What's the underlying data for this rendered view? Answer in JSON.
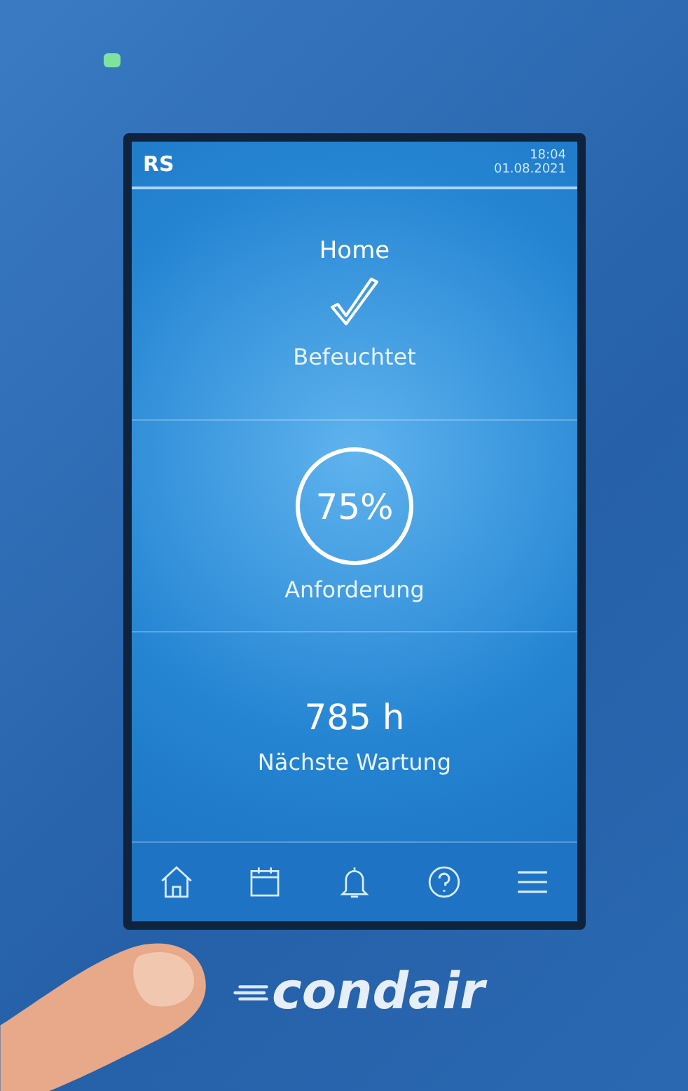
{
  "header": {
    "title": "RS",
    "time": "18:04",
    "date": "01.08.2021"
  },
  "screen_title": "Home",
  "status": {
    "label": "Befeuchtet"
  },
  "demand": {
    "value": "75%",
    "label": "Anforderung"
  },
  "maintenance": {
    "value": "785 h",
    "label": "Nächste Wartung"
  },
  "nav": [
    {
      "kind": "home"
    },
    {
      "kind": "calendar"
    },
    {
      "kind": "bell"
    },
    {
      "kind": "help"
    },
    {
      "kind": "menu"
    }
  ],
  "brand": "condair"
}
